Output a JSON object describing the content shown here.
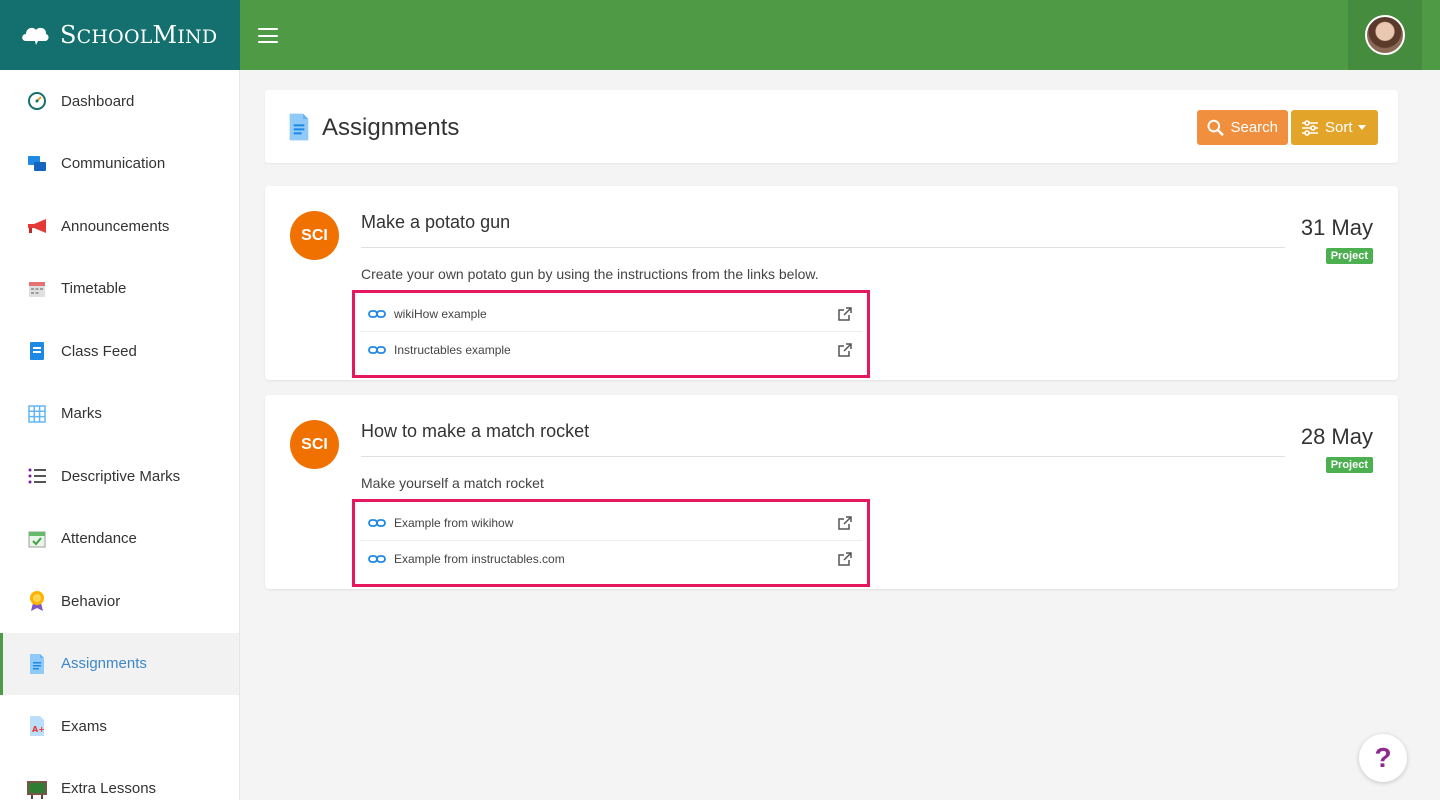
{
  "brand": {
    "name_big1": "S",
    "name_small1": "CHOOL",
    "name_big2": "M",
    "name_small2": "IND"
  },
  "page": {
    "title": "Assignments"
  },
  "toolbar": {
    "search_label": "Search",
    "sort_label": "Sort"
  },
  "colors": {
    "topbar": "#4e9a45",
    "brand": "#13706e",
    "search": "#f0903e",
    "sort": "#e3a42a",
    "subject": "#f07000",
    "tag": "#4caf50",
    "highlight": "#e5185f",
    "active_text": "#3d87c9"
  },
  "sidebar": {
    "items": [
      {
        "label": "Dashboard",
        "icon": "dashboard-icon"
      },
      {
        "label": "Communication",
        "icon": "chat-icon"
      },
      {
        "label": "Announcements",
        "icon": "megaphone-icon"
      },
      {
        "label": "Timetable",
        "icon": "calendar-icon"
      },
      {
        "label": "Class Feed",
        "icon": "feed-icon"
      },
      {
        "label": "Marks",
        "icon": "grid-icon"
      },
      {
        "label": "Descriptive Marks",
        "icon": "list-icon"
      },
      {
        "label": "Attendance",
        "icon": "attendance-icon"
      },
      {
        "label": "Behavior",
        "icon": "medal-icon"
      },
      {
        "label": "Assignments",
        "icon": "document-icon",
        "active": true
      },
      {
        "label": "Exams",
        "icon": "exam-icon"
      },
      {
        "label": "Extra Lessons",
        "icon": "blackboard-icon"
      }
    ]
  },
  "assignments": [
    {
      "subject": "SCI",
      "title": "Make a potato gun",
      "date": "31 May",
      "tag": "Project",
      "description": "Create your own potato gun by using the instructions from the links below.",
      "links": [
        "wikiHow example",
        "Instructables example"
      ]
    },
    {
      "subject": "SCI",
      "title": "How to make a match rocket",
      "date": "28 May",
      "tag": "Project",
      "description": "Make yourself a match rocket",
      "links": [
        "Example from wikihow",
        "Example from instructables.com"
      ]
    }
  ],
  "help": {
    "label": "?"
  }
}
